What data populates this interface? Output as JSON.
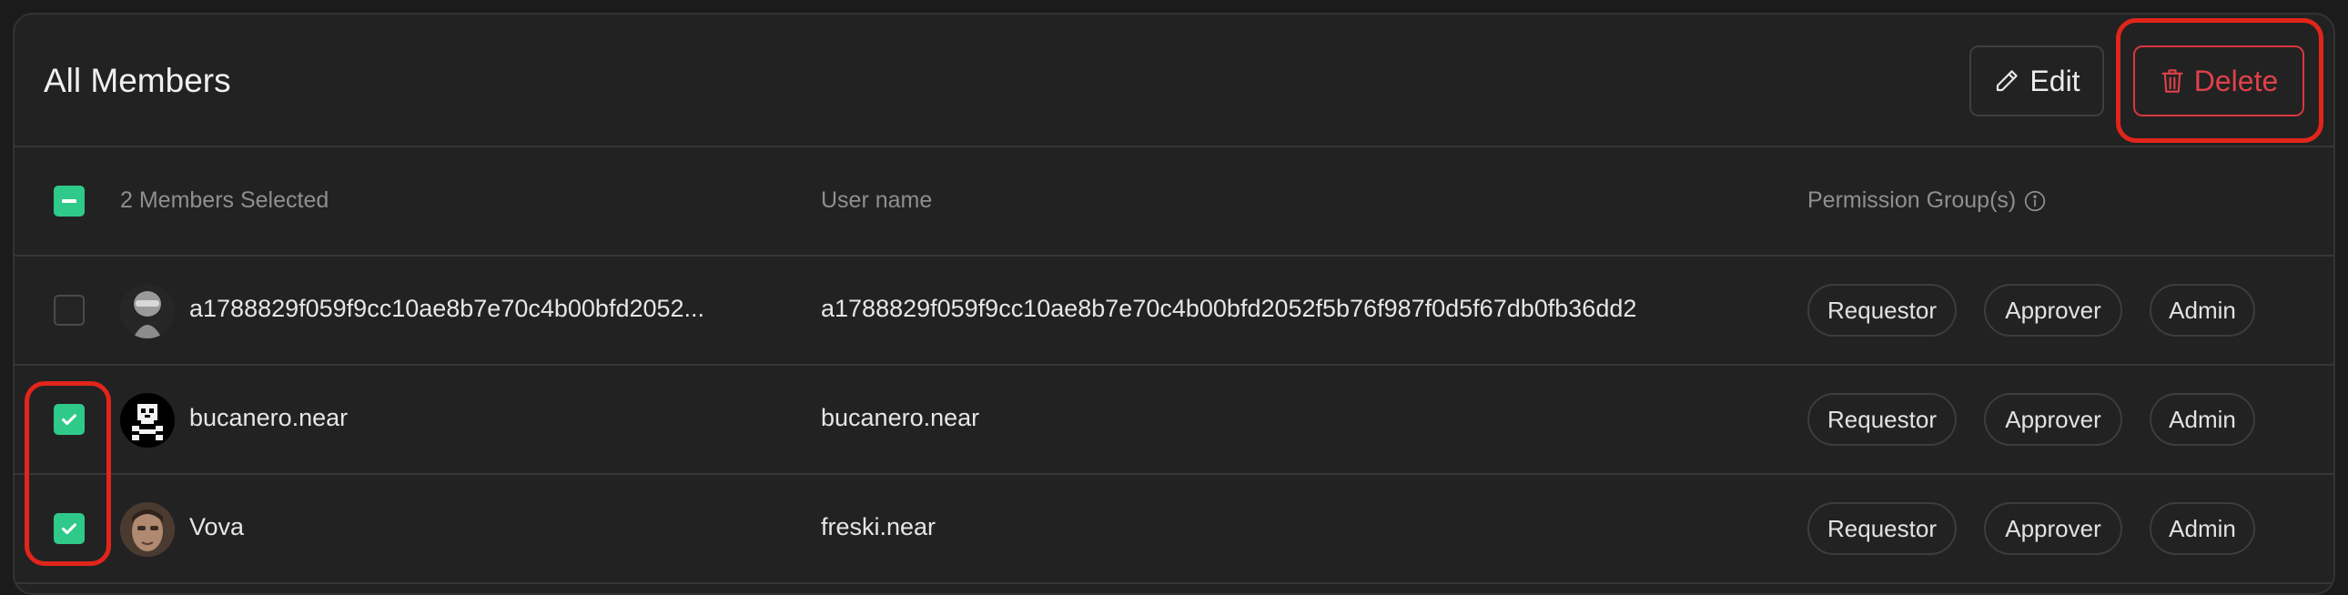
{
  "header": {
    "title": "All Members",
    "edit_label": "Edit",
    "delete_label": "Delete"
  },
  "table": {
    "selection_summary": "2 Members Selected",
    "username_header": "User name",
    "permission_header": "Permission Group(s)",
    "rows": [
      {
        "member": "a1788829f059f9cc10ae8b7e70c4b00bfd2052...",
        "username": "a1788829f059f9cc10ae8b7e70c4b00bfd2052f5b76f987f0d5f67db0fb36dd2",
        "selected": false,
        "groups": [
          "Requestor",
          "Approver",
          "Admin"
        ]
      },
      {
        "member": "bucanero.near",
        "username": "bucanero.near",
        "selected": true,
        "groups": [
          "Requestor",
          "Approver",
          "Admin"
        ]
      },
      {
        "member": "Vova",
        "username": "freski.near",
        "selected": true,
        "groups": [
          "Requestor",
          "Approver",
          "Admin"
        ]
      }
    ]
  },
  "colors": {
    "accent_green": "#2fc98a",
    "danger_red": "#e0414a",
    "highlight_red": "#e1251b"
  }
}
